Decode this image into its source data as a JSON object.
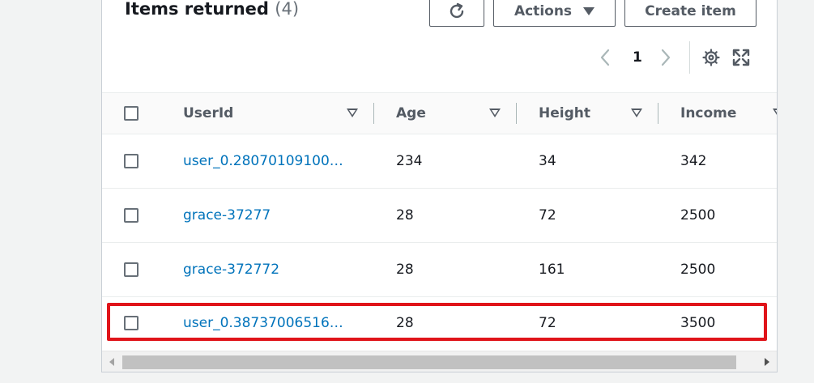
{
  "header": {
    "title": "Items returned",
    "count": "(4)",
    "actions_label": "Actions",
    "create_label": "Create item"
  },
  "pagination": {
    "current_page": "1"
  },
  "table": {
    "columns": [
      "UserId",
      "Age",
      "Height",
      "Income"
    ],
    "rows": [
      {
        "userid": "user_0.28070109100…",
        "age": "234",
        "height": "34",
        "income": "342"
      },
      {
        "userid": "grace-37277",
        "age": "28",
        "height": "72",
        "income": "2500"
      },
      {
        "userid": "grace-372772",
        "age": "28",
        "height": "161",
        "income": "2500"
      },
      {
        "userid": "user_0.38737006516…",
        "age": "28",
        "height": "72",
        "income": "3500"
      }
    ]
  },
  "colors": {
    "link": "#0073bb",
    "highlight": "#e0141a",
    "text": "#16191f"
  },
  "icons": {
    "refresh": "refresh-icon",
    "actions": "caret-down-icon",
    "prev": "chevron-left-icon",
    "next": "chevron-right-icon",
    "settings": "gear-icon",
    "fullscreen": "expand-icon",
    "sort": "sort-caret-icon"
  }
}
